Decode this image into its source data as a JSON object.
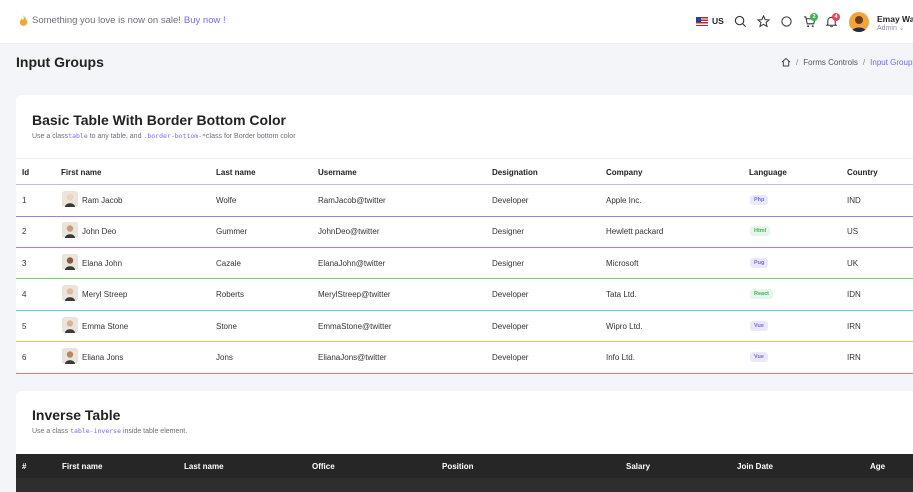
{
  "topbar": {
    "promo_text": "Something you love is now on sale!",
    "promo_link": "Buy now !",
    "locale": "US",
    "cart_count": "2",
    "notif_count": "4",
    "user_name": "Emay Walter",
    "user_role": "Admin"
  },
  "page": {
    "title": "Input Groups",
    "breadcrumb": [
      "Forms Controls",
      "Input Groups"
    ]
  },
  "table1": {
    "title": "Basic Table With Border Bottom Color",
    "subtitle_pre": "Use a class",
    "subtitle_code1": "table",
    "subtitle_mid": " to any table, and ",
    "subtitle_code2": ".border-bottom-*",
    "subtitle_post": "class for Border bottom color",
    "headers": [
      "Id",
      "First name",
      "Last name",
      "Username",
      "Designation",
      "Company",
      "Language",
      "Country"
    ],
    "rows": [
      {
        "id": "1",
        "first": "Ram Jacob",
        "last": "Wolfe",
        "user": "RamJacob@twitter",
        "designation": "Developer",
        "company": "Apple Inc.",
        "language": "Php",
        "country": "IND",
        "border": "#a07ce8",
        "pill_bg": "#ece8fb",
        "pill_fg": "#6f6cf0"
      },
      {
        "id": "2",
        "first": "John Deo",
        "last": "Gummer",
        "user": "JohnDeo@twitter",
        "designation": "Designer",
        "company": "Hewlett packard",
        "language": "Html",
        "country": "US",
        "border": "#f06a8a",
        "pill_bg": "#e7f6ea",
        "pill_fg": "#3fb25a"
      },
      {
        "id": "3",
        "first": "Elana John",
        "last": "Cazale",
        "user": "ElanaJohn@twitter",
        "designation": "Designer",
        "company": "Microsoft",
        "language": "Pug",
        "country": "UK",
        "border": "#7ec86a",
        "pill_bg": "#ece8fb",
        "pill_fg": "#6f6cf0"
      },
      {
        "id": "4",
        "first": "Meryl Streep",
        "last": "Roberts",
        "user": "MerylStreep@twitter",
        "designation": "Developer",
        "company": "Tata Ltd.",
        "language": "React",
        "country": "IDN",
        "border": "#5ad0e6",
        "pill_bg": "#e7f6ea",
        "pill_fg": "#3fb25a"
      },
      {
        "id": "5",
        "first": "Emma Stone",
        "last": "Stone",
        "user": "EmmaStone@twitter",
        "designation": "Developer",
        "company": "Wipro Ltd.",
        "language": "Vue",
        "country": "IRN",
        "border": "#f2b65a",
        "pill_bg": "#ece8fb",
        "pill_fg": "#6f6cf0"
      },
      {
        "id": "6",
        "first": "Eliana Jons",
        "last": "Jons",
        "user": "ElianaJons@twitter",
        "designation": "Developer",
        "company": "Info Ltd.",
        "language": "Vue",
        "country": "IRN",
        "border": "#f07a6a",
        "pill_bg": "#ece8fb",
        "pill_fg": "#6f6cf0"
      }
    ]
  },
  "table2": {
    "title": "Inverse Table",
    "subtitle_pre": "Use a class ",
    "subtitle_code": "table-inverse",
    "subtitle_post": " inside table element.",
    "headers": [
      "#",
      "First name",
      "Last name",
      "Office",
      "Position",
      "Salary",
      "Join Date",
      "Age"
    ]
  }
}
